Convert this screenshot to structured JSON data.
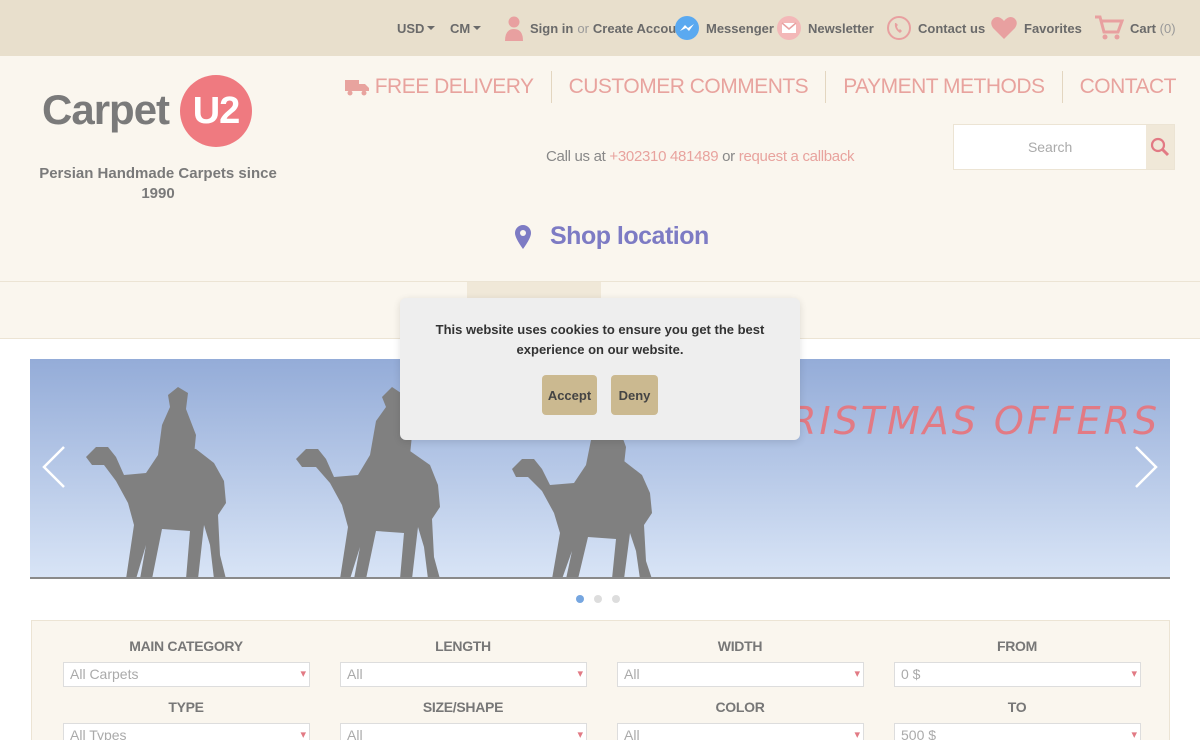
{
  "topbar": {
    "currency": "USD",
    "unit": "CM",
    "signin": "Sign in",
    "or": "or",
    "create": "Create Account",
    "messenger": "Messenger",
    "newsletter": "Newsletter",
    "contact": "Contact us",
    "favorites": "Favorites",
    "cart": "Cart",
    "cart_count": "(0)"
  },
  "header": {
    "logo_word": "Carpet",
    "logo_badge": "U2",
    "tagline": "Persian Handmade Carpets since 1990",
    "nav": [
      "FREE DELIVERY",
      "CUSTOMER COMMENTS",
      "PAYMENT METHODS",
      "CONTACT"
    ],
    "call_prefix": "Call us at",
    "phone": "+302310 481489",
    "call_or": "or",
    "callback": "request a callback",
    "search_placeholder": "Search",
    "shop_location": "Shop location"
  },
  "banner": {
    "text": "RISTMAS OFFERS",
    "slides": 3,
    "active_slide": 1
  },
  "filters": {
    "row1": [
      {
        "label": "MAIN CATEGORY",
        "value": "All Carpets"
      },
      {
        "label": "LENGTH",
        "value": "All"
      },
      {
        "label": "WIDTH",
        "value": "All"
      },
      {
        "label": "FROM",
        "value": "0 $"
      }
    ],
    "row2": [
      {
        "label": "TYPE",
        "value": "All Types"
      },
      {
        "label": "SIZE/SHAPE",
        "value": "All"
      },
      {
        "label": "COLOR",
        "value": "All"
      },
      {
        "label": "TO",
        "value": "500 $"
      }
    ]
  },
  "cookie": {
    "text": "This website uses cookies to ensure you get the best experience on our website.",
    "accept": "Accept",
    "deny": "Deny"
  },
  "colors": {
    "topbar_bg": "#e8dfcc",
    "header_bg": "#faf6ee",
    "accent_pink": "#ef7a80",
    "shop_location": "#7d7bc4",
    "button": "#cbb990"
  }
}
